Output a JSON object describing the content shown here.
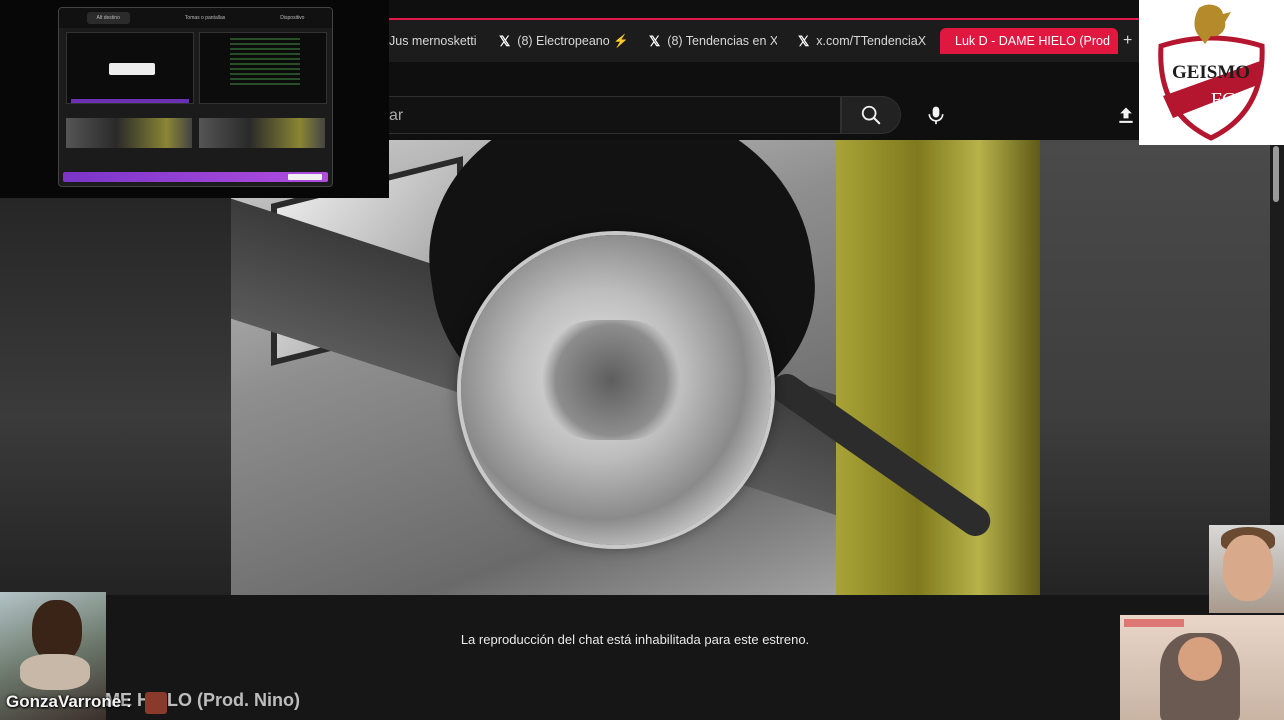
{
  "browser": {
    "tabs": [
      {
        "label": "Jus mernosketti",
        "icon": "generic-tab"
      },
      {
        "label": "(8) Electropeano ⚡·",
        "icon": "x-logo"
      },
      {
        "label": "(8) Tendencias en X",
        "icon": "x-logo"
      },
      {
        "label": "x.com/TTendenciaX",
        "icon": "x-logo"
      },
      {
        "label": "Luk D - DAME HIELO (Prod",
        "icon": "youtube-logo",
        "active": true
      }
    ],
    "new_tab_label": "+",
    "accent_color": "#e0173f"
  },
  "youtube": {
    "search_value": "ar",
    "search_icon": "search-icon",
    "mic_icon": "mic-icon",
    "upload_icon": "upload-icon"
  },
  "video": {
    "description": ""
  },
  "chat": {
    "notice": "La reproducción del chat está inhabilitada para este estreno.",
    "scrolling_title": "ME HIELO (Prod. Nino)"
  },
  "stream_overlay": {
    "username": "GonzaVarrone :",
    "logo_text": "GEISMO",
    "logo_sub": "FC",
    "obs_tabs": [
      "Alt destino",
      "Tomas o pantallas",
      "Dispositivo"
    ]
  }
}
